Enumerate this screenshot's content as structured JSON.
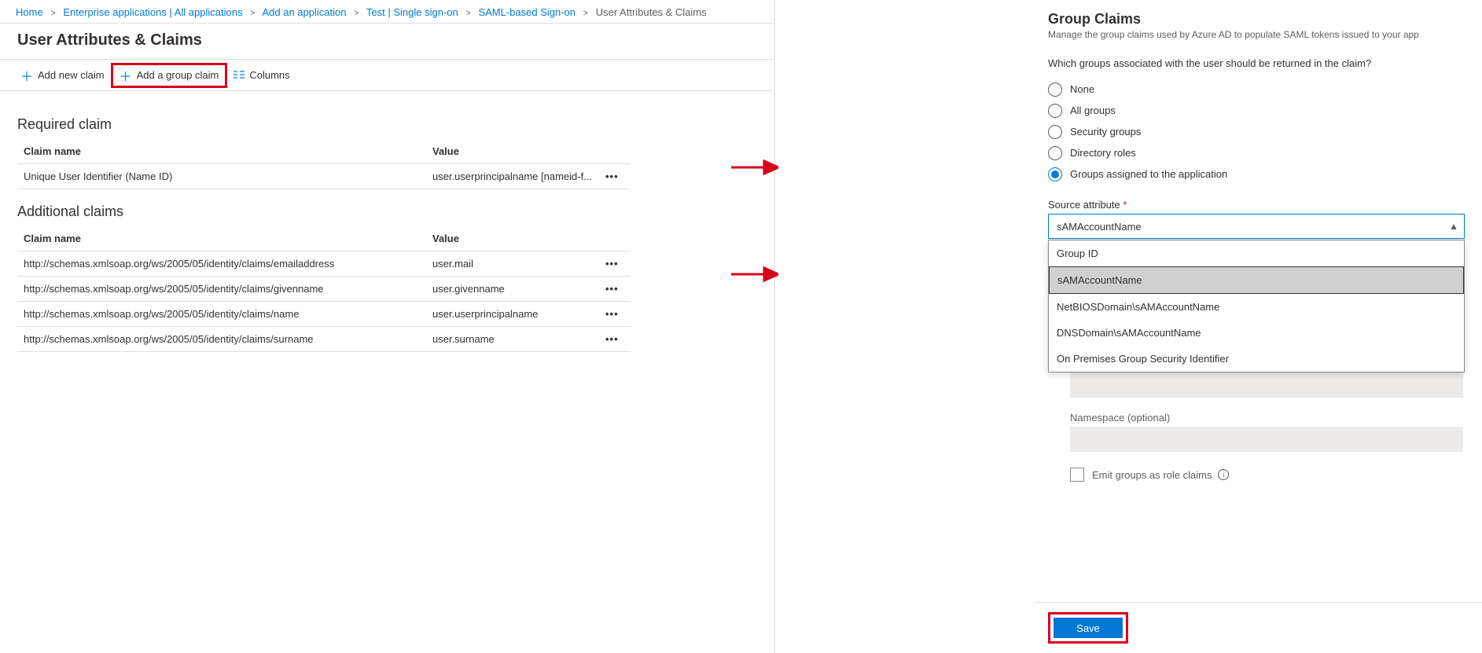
{
  "breadcrumbs": [
    {
      "label": "Home",
      "active": false
    },
    {
      "label": "Enterprise applications | All applications",
      "active": false
    },
    {
      "label": "Add an application",
      "active": false
    },
    {
      "label": "Test | Single sign-on",
      "active": false
    },
    {
      "label": "SAML-based Sign-on",
      "active": false
    },
    {
      "label": "User Attributes & Claims",
      "active": true
    }
  ],
  "page_title": "User Attributes & Claims",
  "toolbar": {
    "add_claim": "Add new claim",
    "add_group_claim": "Add a group claim",
    "columns": "Columns"
  },
  "required_section": {
    "title": "Required claim",
    "headers": {
      "name": "Claim name",
      "value": "Value"
    },
    "rows": [
      {
        "name": "Unique User Identifier (Name ID)",
        "value": "user.userprincipalname [nameid-f..."
      }
    ]
  },
  "additional_section": {
    "title": "Additional claims",
    "headers": {
      "name": "Claim name",
      "value": "Value"
    },
    "rows": [
      {
        "name": "http://schemas.xmlsoap.org/ws/2005/05/identity/claims/emailaddress",
        "value": "user.mail"
      },
      {
        "name": "http://schemas.xmlsoap.org/ws/2005/05/identity/claims/givenname",
        "value": "user.givenname"
      },
      {
        "name": "http://schemas.xmlsoap.org/ws/2005/05/identity/claims/name",
        "value": "user.userprincipalname"
      },
      {
        "name": "http://schemas.xmlsoap.org/ws/2005/05/identity/claims/surname",
        "value": "user.surname"
      }
    ]
  },
  "panel": {
    "title": "Group Claims",
    "subtitle": "Manage the group claims used by Azure AD to populate SAML tokens issued to your app",
    "question": "Which groups associated with the user should be returned in the claim?",
    "radio_options": [
      {
        "label": "None",
        "checked": false
      },
      {
        "label": "All groups",
        "checked": false
      },
      {
        "label": "Security groups",
        "checked": false
      },
      {
        "label": "Directory roles",
        "checked": false
      },
      {
        "label": "Groups assigned to the application",
        "checked": true
      }
    ],
    "source_attribute_label": "Source attribute",
    "source_attribute_value": "sAMAccountName",
    "source_attribute_options": [
      "Group ID",
      "sAMAccountName",
      "NetBIOSDomain\\sAMAccountName",
      "DNSDomain\\sAMAccountName",
      "On Premises Group Security Identifier"
    ],
    "namespace_label": "Namespace (optional)",
    "emit_roles_label": "Emit groups as role claims",
    "save_label": "Save"
  }
}
